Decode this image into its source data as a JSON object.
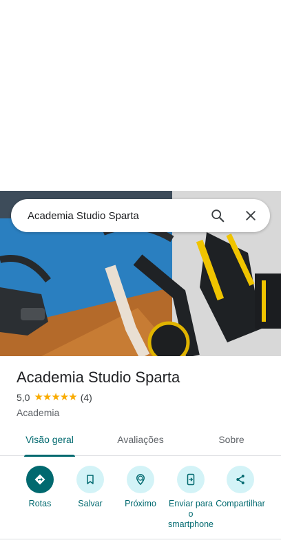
{
  "search": {
    "query": "Academia Studio Sparta"
  },
  "place": {
    "name": "Academia Studio Sparta",
    "rating": "5,0",
    "stars": "★★★★★",
    "review_count": "(4)",
    "category": "Academia"
  },
  "tabs": [
    {
      "label": "Visão geral",
      "active": true
    },
    {
      "label": "Avaliações",
      "active": false
    },
    {
      "label": "Sobre",
      "active": false
    }
  ],
  "actions": [
    {
      "label": "Rotas",
      "icon": "directions-icon",
      "primary": true
    },
    {
      "label": "Salvar",
      "icon": "bookmark-icon",
      "primary": false
    },
    {
      "label": "Próximo",
      "icon": "nearby-icon",
      "primary": false
    },
    {
      "label": "Enviar para o smartphone",
      "icon": "send-to-phone-icon",
      "primary": false
    },
    {
      "label": "Compartilhar",
      "icon": "share-icon",
      "primary": false
    }
  ],
  "colors": {
    "accent": "#01696f",
    "action_bg": "#d3f3f7",
    "star": "#f9ab00",
    "divider": "#dadce0"
  }
}
